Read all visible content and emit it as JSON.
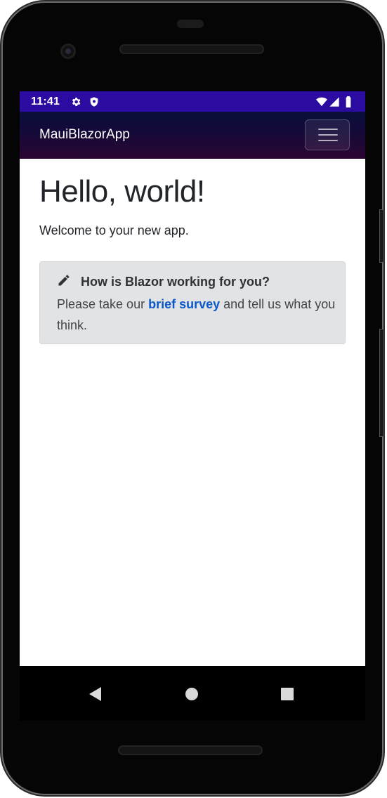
{
  "status_bar": {
    "time": "11:41",
    "icons": [
      "gear-icon",
      "shield-icon",
      "wifi-icon",
      "signal-icon",
      "battery-icon"
    ],
    "background": "#2b0ba0"
  },
  "app_bar": {
    "brand": "MauiBlazorApp",
    "menu_icon": "hamburger-menu-icon"
  },
  "main": {
    "title": "Hello, world!",
    "welcome": "Welcome to your new app.",
    "survey": {
      "icon": "pencil-icon",
      "heading": "How is Blazor working for you?",
      "text_before": "Please take our ",
      "link_label": "brief survey",
      "text_after": " and tell us what you think."
    }
  },
  "nav_bar": {
    "buttons": [
      "back-icon",
      "home-icon",
      "recents-icon"
    ]
  },
  "colors": {
    "link": "#0a58ca",
    "alert_bg": "#e2e3e5",
    "text": "#212529"
  }
}
